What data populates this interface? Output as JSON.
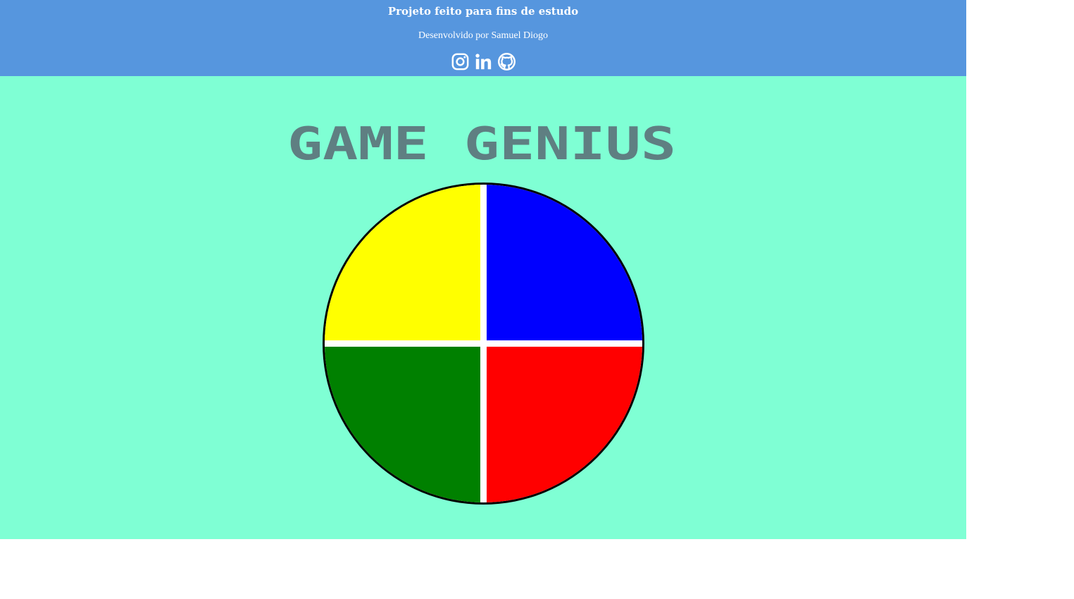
{
  "header": {
    "title": "Projeto feito para fins de estudo",
    "subtitle": "Desenvolvido por Samuel Diogo",
    "socials": [
      {
        "icon": "instagram-icon"
      },
      {
        "icon": "linkedin-icon"
      },
      {
        "icon": "github-icon"
      }
    ],
    "background": "#5696de"
  },
  "game": {
    "title": "GAME GENIUS",
    "title_color": "#5f7f82",
    "background": "#7fffd4",
    "quadrants": [
      {
        "name": "yellow",
        "color": "#ffff00"
      },
      {
        "name": "blue",
        "color": "#0000ff"
      },
      {
        "name": "green",
        "color": "#008000"
      },
      {
        "name": "red",
        "color": "#ff0000"
      }
    ]
  }
}
